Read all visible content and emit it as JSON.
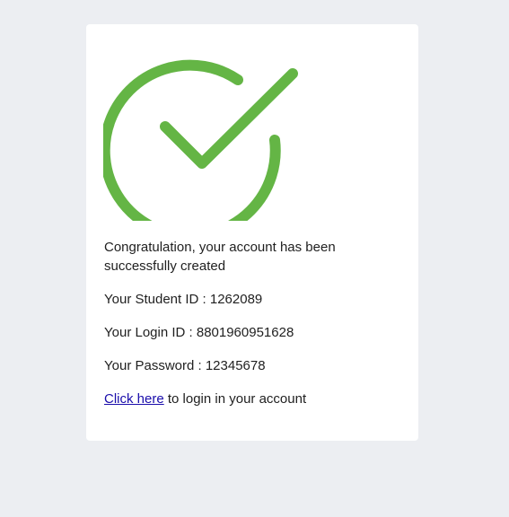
{
  "success": {
    "icon": "check-circle-icon",
    "accent_color": "#64b545",
    "message": "Congratulation, your account has been successfully created",
    "student_id_text": "Your Student ID : 1262089",
    "login_id_text": "Your Login ID : 8801960951628",
    "password_text": "Your Password : 12345678",
    "link_text": "Click here",
    "link_suffix": " to login in your account"
  }
}
